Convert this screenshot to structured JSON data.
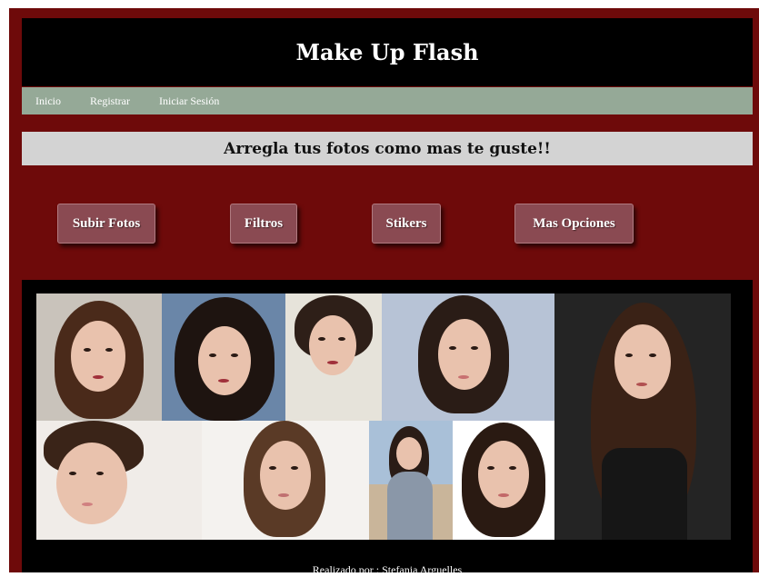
{
  "header": {
    "title": "Make Up Flash"
  },
  "nav": {
    "items": [
      "Inicio",
      "Registrar",
      "Iniciar Sesión"
    ]
  },
  "tagline": "Arregla tus fotos como mas te guste!!",
  "buttons": {
    "upload": "Subir Fotos",
    "filters": "Filtros",
    "stickers": "Stikers",
    "more": "Mas Opciones"
  },
  "footer": {
    "text": "Realizado por : Stefania Arguelles"
  },
  "colors": {
    "page_bg": "#6e0a0a",
    "header_bg": "#000000",
    "nav_bg": "#95a997",
    "tagline_bg": "#d3d3d3",
    "button_bg": "#8a4a52"
  }
}
